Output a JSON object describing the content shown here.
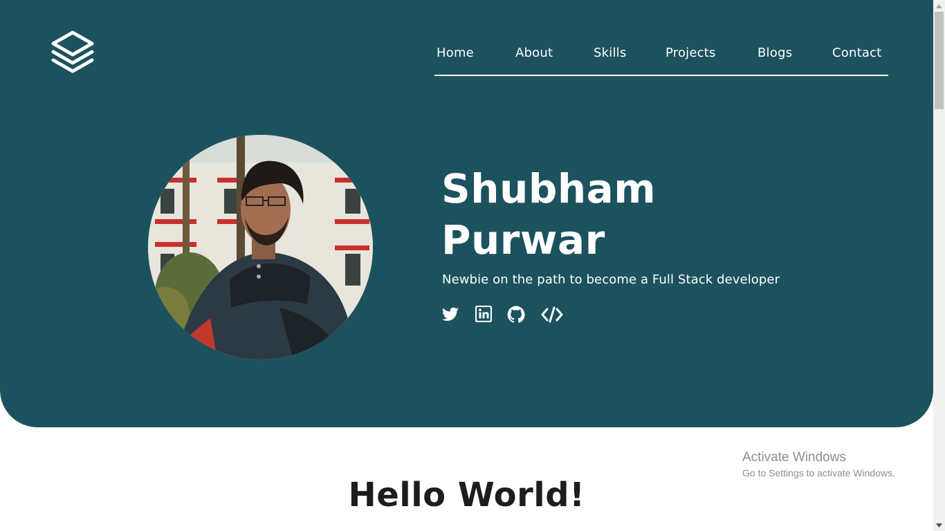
{
  "nav": {
    "items": [
      {
        "label": "Home"
      },
      {
        "label": "About"
      },
      {
        "label": "Skills"
      },
      {
        "label": "Projects"
      },
      {
        "label": "Blogs"
      },
      {
        "label": "Contact"
      }
    ]
  },
  "hero": {
    "name_line1": "Shubham",
    "name_line2": "Purwar",
    "tagline": "Newbie on the path to become a Full Stack developer",
    "socials": [
      "twitter-icon",
      "linkedin-icon",
      "github-icon",
      "code-icon"
    ]
  },
  "section": {
    "heading": "Hello World!"
  },
  "watermark": {
    "title": "Activate Windows",
    "subtitle": "Go to Settings to activate Windows."
  },
  "colors": {
    "hero_bg": "#1c525e",
    "text_light": "#ffffff",
    "heading_dark": "#1d1d1d",
    "watermark": "#8d8d8d"
  }
}
